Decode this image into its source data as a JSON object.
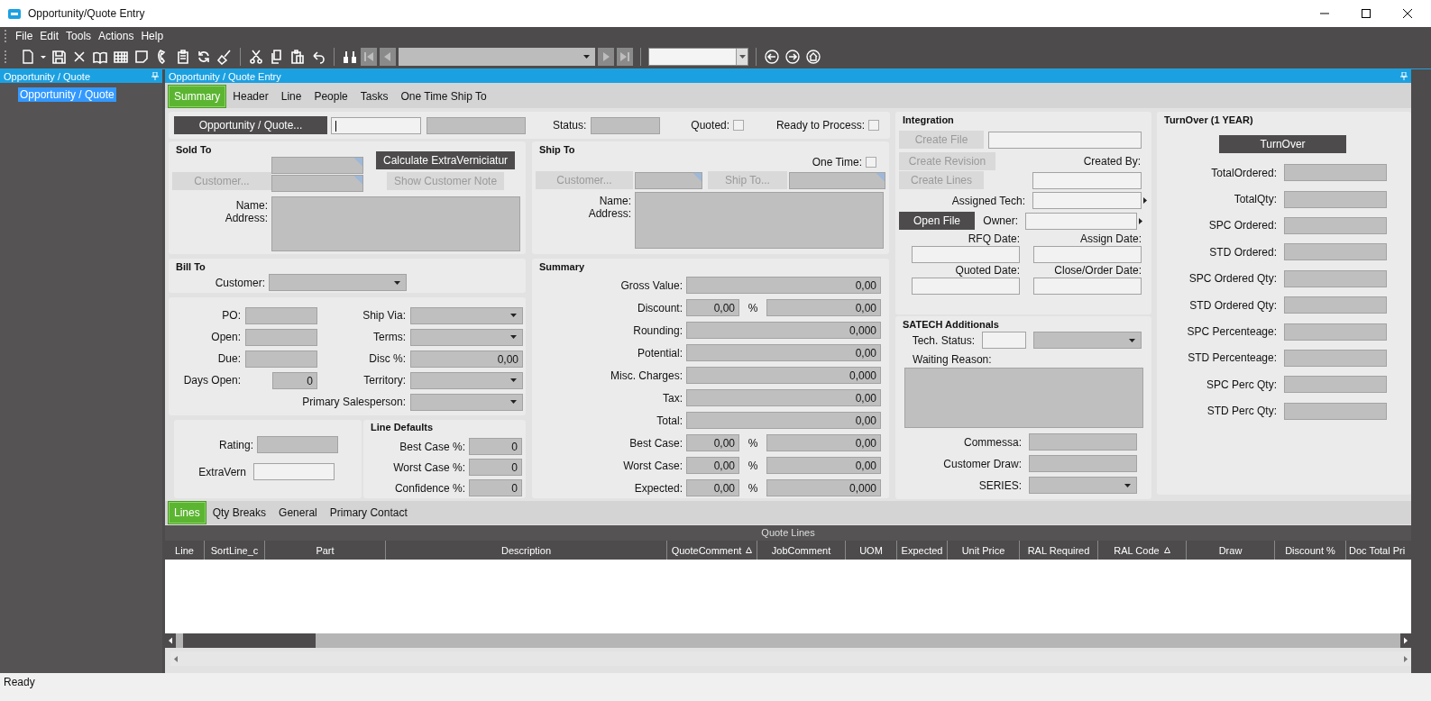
{
  "window": {
    "title": "Opportunity/Quote Entry"
  },
  "menu": [
    "File",
    "Edit",
    "Tools",
    "Actions",
    "Help"
  ],
  "navigator": {
    "title": "Opportunity / Quote",
    "items": [
      {
        "label": "Opportunity / Quote",
        "selected": true
      }
    ]
  },
  "form_title": "Opportunity / Quote Entry",
  "tabs": [
    {
      "label": "Summary",
      "selected": true
    },
    {
      "label": "Header",
      "selected": false
    },
    {
      "label": "Line",
      "selected": false
    },
    {
      "label": "People",
      "selected": false
    },
    {
      "label": "Tasks",
      "selected": false
    },
    {
      "label": "One Time Ship To",
      "selected": false
    }
  ],
  "top_row": {
    "button": {
      "label": "Opportunity / Quote...",
      "disabled": false
    },
    "status_label": "Status:",
    "quoted": {
      "label": "Quoted:",
      "checked": false
    },
    "ready_to_process": {
      "label": "Ready to Process:",
      "checked": false
    }
  },
  "sold_to": {
    "title": "Sold To",
    "customer_button": {
      "label": "Customer...",
      "disabled": true
    },
    "calculate_button": {
      "label": "Calculate ExtraVerniciatur",
      "disabled": false
    },
    "note_button": {
      "label": "Show Customer Note",
      "disabled": true
    },
    "name_label": "Name:",
    "address_label": "Address:"
  },
  "bill_to": {
    "title": "Bill To",
    "customer_label": "Customer:"
  },
  "order_left": [
    {
      "label": "PO:",
      "kind": "text"
    },
    {
      "label": "Open:",
      "kind": "text"
    },
    {
      "label": "Due:",
      "kind": "text"
    },
    {
      "label": "Days Open:",
      "kind": "number",
      "value": "0"
    }
  ],
  "order_right": [
    {
      "label": "Ship Via:",
      "kind": "dropdown"
    },
    {
      "label": "Terms:",
      "kind": "dropdown"
    },
    {
      "label": "Disc %:",
      "kind": "number",
      "value": "0,00"
    },
    {
      "label": "Territory:",
      "kind": "dropdown"
    },
    {
      "label": "Primary Salesperson:",
      "kind": "dropdown"
    }
  ],
  "rating": {
    "label": "Rating:"
  },
  "extravern": {
    "label": "ExtraVern"
  },
  "line_defaults": {
    "title": "Line Defaults",
    "fields": [
      {
        "label": "Best Case %:",
        "value": "0"
      },
      {
        "label": "Worst Case %:",
        "value": "0"
      },
      {
        "label": "Confidence %:",
        "value": "0"
      }
    ]
  },
  "ship_to": {
    "title": "Ship To",
    "one_time": {
      "label": "One Time:",
      "checked": false
    },
    "customer_button": {
      "label": "Customer...",
      "disabled": true
    },
    "ship_to_button": {
      "label": "Ship To...",
      "disabled": true
    },
    "name_label": "Name:",
    "address_label": "Address:"
  },
  "summary": {
    "title": "Summary",
    "rows": [
      {
        "kind": "single",
        "label": "Gross Value:",
        "value": "0,00"
      },
      {
        "kind": "split",
        "label": "Discount:",
        "percent": "0,00",
        "unit": "%",
        "value": "0,00"
      },
      {
        "kind": "single",
        "label": "Rounding:",
        "value": "0,000"
      },
      {
        "kind": "single",
        "label": "Potential:",
        "value": "0,00"
      },
      {
        "kind": "single",
        "label": "Misc. Charges:",
        "value": "0,000"
      },
      {
        "kind": "single",
        "label": "Tax:",
        "value": "0,00"
      },
      {
        "kind": "single",
        "label": "Total:",
        "value": "0,00"
      },
      {
        "kind": "split",
        "label": "Best Case:",
        "percent": "0,00",
        "unit": "%",
        "value": "0,00"
      },
      {
        "kind": "split",
        "label": "Worst Case:",
        "percent": "0,00",
        "unit": "%",
        "value": "0,00"
      },
      {
        "kind": "split",
        "label": "Expected:",
        "percent": "0,00",
        "unit": "%",
        "value": "0,000"
      }
    ]
  },
  "integration": {
    "title": "Integration",
    "create_file": {
      "label": "Create File",
      "disabled": true
    },
    "create_revision": {
      "label": "Create Revision",
      "disabled": true
    },
    "created_by_label": "Created By:",
    "create_lines": {
      "label": "Create Lines",
      "disabled": true
    },
    "assigned_tech_label": "Assigned Tech:",
    "open_file": {
      "label": "Open File",
      "disabled": false
    },
    "owner_label": "Owner:",
    "rfq_date_label": "RFQ Date:",
    "assign_date_label": "Assign Date:",
    "quoted_date_label": "Quoted Date:",
    "close_date_label": "Close/Order Date:"
  },
  "satech": {
    "title": "SATECH Additionals",
    "tech_status_label": "Tech. Status:",
    "waiting_reason_label": "Waiting Reason:",
    "fields": [
      {
        "label": "Commessa:",
        "kind": "text"
      },
      {
        "label": "Customer Draw:",
        "kind": "text"
      },
      {
        "label": "SERIES:",
        "kind": "dropdown"
      }
    ]
  },
  "turnover": {
    "title": "TurnOver (1 YEAR)",
    "button": {
      "label": "TurnOver",
      "disabled": false
    },
    "fields": [
      "TotalOrdered:",
      "TotalQty:",
      "SPC Ordered:",
      "STD Ordered:",
      "SPC Ordered Qty:",
      "STD Ordered Qty:",
      "SPC Percenteage:",
      "STD Percenteage:",
      "SPC Perc Qty:",
      "STD Perc Qty:"
    ]
  },
  "lower_tabs": [
    {
      "label": "Lines",
      "selected": true
    },
    {
      "label": "Qty Breaks",
      "selected": false
    },
    {
      "label": "General",
      "selected": false
    },
    {
      "label": "Primary Contact",
      "selected": false
    }
  ],
  "quote_lines": {
    "title": "Quote Lines",
    "columns": [
      {
        "label": "Line",
        "sorted": false
      },
      {
        "label": "SortLine_c",
        "sorted": false
      },
      {
        "label": "Part",
        "sorted": false
      },
      {
        "label": "Description",
        "sorted": false
      },
      {
        "label": "QuoteComment",
        "sorted": true
      },
      {
        "label": "JobComment",
        "sorted": false
      },
      {
        "label": "UOM",
        "sorted": false
      },
      {
        "label": "Expected",
        "sorted": false
      },
      {
        "label": "Unit Price",
        "sorted": false
      },
      {
        "label": "RAL Required",
        "sorted": false
      },
      {
        "label": "RAL Code",
        "sorted": true
      },
      {
        "label": "Draw",
        "sorted": false
      },
      {
        "label": "Discount %",
        "sorted": false
      },
      {
        "label": "Doc Total Pri",
        "sorted": false
      }
    ]
  },
  "status_bar": {
    "text": "Ready"
  }
}
